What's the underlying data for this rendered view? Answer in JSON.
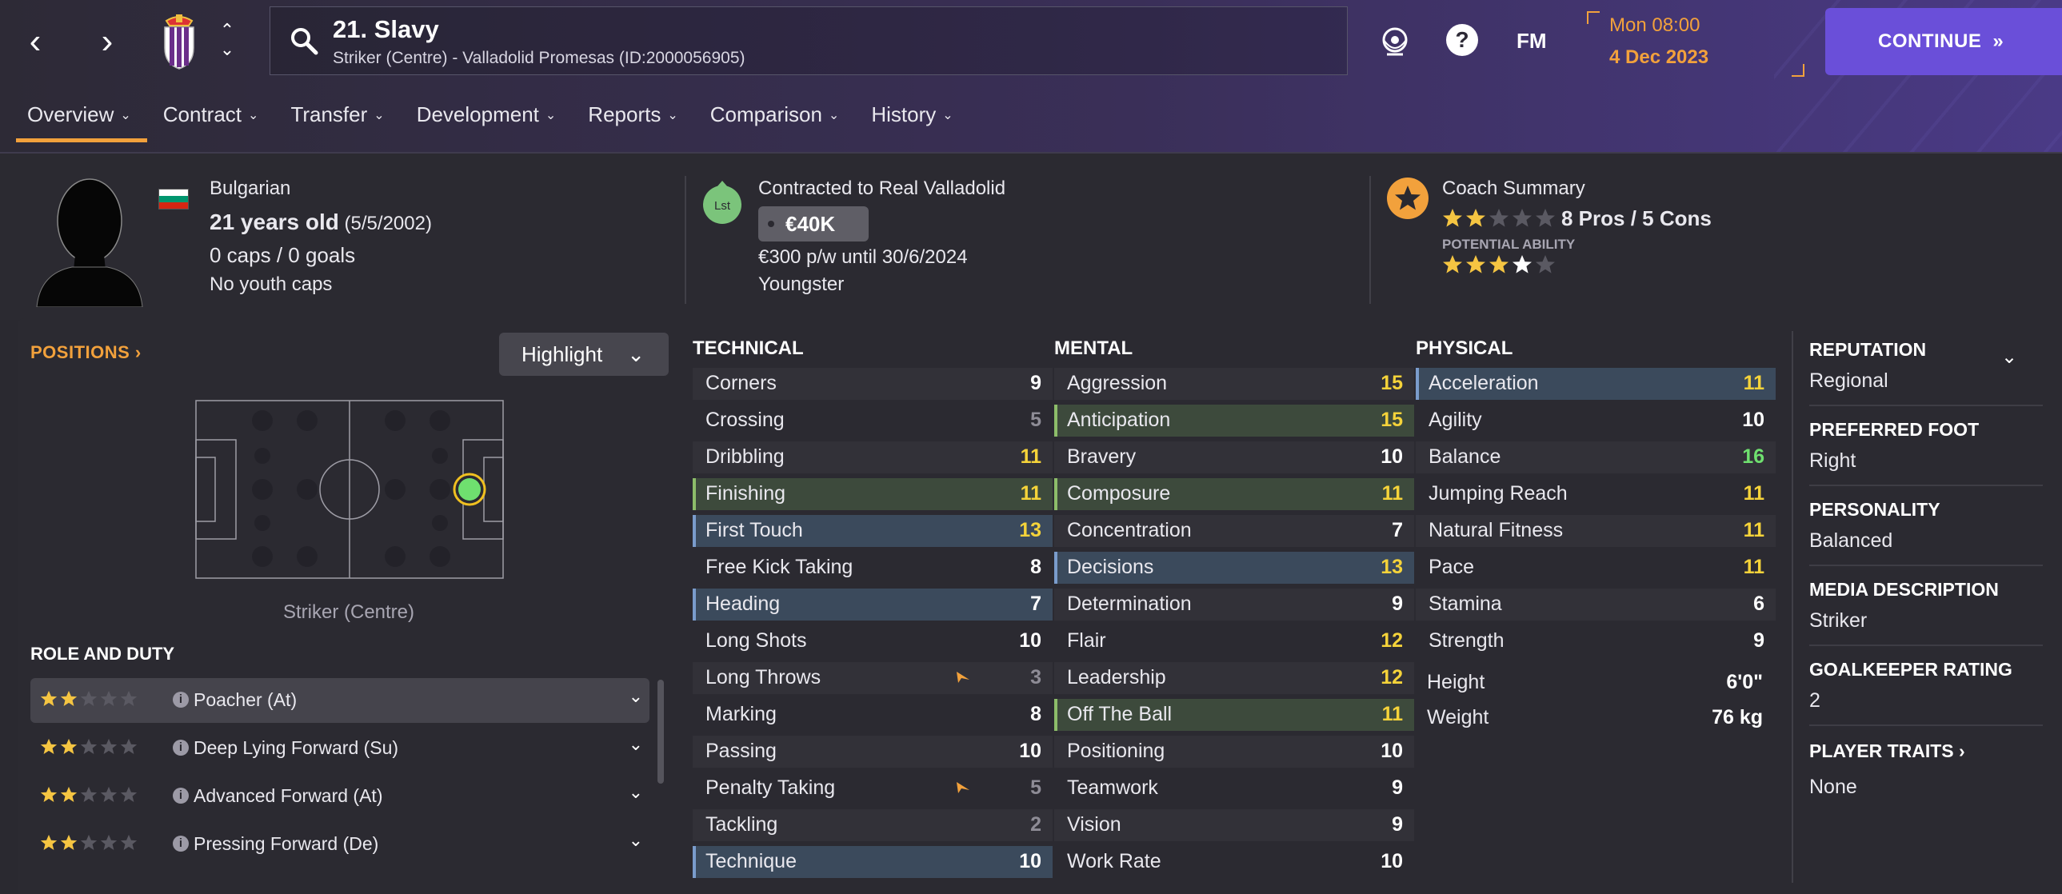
{
  "header": {
    "player_name": "21. Slavy",
    "player_subtitle": "Striker (Centre) - Valladolid Promesas (ID:2000056905)",
    "fm_label": "FM",
    "date_time": "Mon 08:00",
    "date": "4 Dec 2023",
    "continue_label": "CONTINUE",
    "help_label": "?"
  },
  "tabs": [
    {
      "label": "Overview",
      "active": true
    },
    {
      "label": "Contract"
    },
    {
      "label": "Transfer"
    },
    {
      "label": "Development"
    },
    {
      "label": "Reports"
    },
    {
      "label": "Comparison"
    },
    {
      "label": "History"
    }
  ],
  "summary": {
    "nationality": "Bulgarian",
    "age_bold": "21 years old",
    "dob": "(5/5/2002)",
    "caps": "0 caps / 0 goals",
    "youth_caps": "No youth caps",
    "contract_title": "Contracted to Real Valladolid",
    "squad_badge": "Lst",
    "value": "€40K",
    "wage": "€300 p/w until 30/6/2024",
    "contract_type": "Youngster",
    "coach_title": "Coach Summary",
    "coach_stars": 2,
    "pros_cons": "8 Pros / 5 Cons",
    "potential_label": "POTENTIAL ABILITY",
    "potential_stars": 3.5
  },
  "positions": {
    "title": "POSITIONS",
    "highlight_label": "Highlight",
    "position_label": "Striker (Centre)"
  },
  "role_duty": {
    "title": "ROLE AND DUTY",
    "roles": [
      {
        "name": "Poacher (At)",
        "stars": 2
      },
      {
        "name": "Deep Lying Forward (Su)",
        "stars": 2
      },
      {
        "name": "Advanced Forward (At)",
        "stars": 2
      },
      {
        "name": "Pressing Forward (De)",
        "stars": 2
      }
    ]
  },
  "attributes": {
    "technical": {
      "title": "TECHNICAL",
      "items": [
        {
          "name": "Corners",
          "value": "9"
        },
        {
          "name": "Crossing",
          "value": "5"
        },
        {
          "name": "Dribbling",
          "value": "11"
        },
        {
          "name": "Finishing",
          "value": "11",
          "hl": "g"
        },
        {
          "name": "First Touch",
          "value": "13",
          "hl": "b"
        },
        {
          "name": "Free Kick Taking",
          "value": "8"
        },
        {
          "name": "Heading",
          "value": "7",
          "hl": "b"
        },
        {
          "name": "Long Shots",
          "value": "10"
        },
        {
          "name": "Long Throws",
          "value": "3",
          "warn": true
        },
        {
          "name": "Marking",
          "value": "8"
        },
        {
          "name": "Passing",
          "value": "10"
        },
        {
          "name": "Penalty Taking",
          "value": "5",
          "warn": true
        },
        {
          "name": "Tackling",
          "value": "2"
        },
        {
          "name": "Technique",
          "value": "10",
          "hl": "b"
        }
      ]
    },
    "mental": {
      "title": "MENTAL",
      "items": [
        {
          "name": "Aggression",
          "value": "15"
        },
        {
          "name": "Anticipation",
          "value": "15",
          "hl": "g"
        },
        {
          "name": "Bravery",
          "value": "10"
        },
        {
          "name": "Composure",
          "value": "11",
          "hl": "g"
        },
        {
          "name": "Concentration",
          "value": "7"
        },
        {
          "name": "Decisions",
          "value": "13",
          "hl": "b"
        },
        {
          "name": "Determination",
          "value": "9"
        },
        {
          "name": "Flair",
          "value": "12"
        },
        {
          "name": "Leadership",
          "value": "12"
        },
        {
          "name": "Off The Ball",
          "value": "11",
          "hl": "g"
        },
        {
          "name": "Positioning",
          "value": "10"
        },
        {
          "name": "Teamwork",
          "value": "9"
        },
        {
          "name": "Vision",
          "value": "9"
        },
        {
          "name": "Work Rate",
          "value": "10"
        }
      ]
    },
    "physical": {
      "title": "PHYSICAL",
      "items": [
        {
          "name": "Acceleration",
          "value": "11",
          "hl": "b"
        },
        {
          "name": "Agility",
          "value": "10"
        },
        {
          "name": "Balance",
          "value": "16"
        },
        {
          "name": "Jumping Reach",
          "value": "11"
        },
        {
          "name": "Natural Fitness",
          "value": "11"
        },
        {
          "name": "Pace",
          "value": "11"
        },
        {
          "name": "Stamina",
          "value": "6"
        },
        {
          "name": "Strength",
          "value": "9"
        }
      ],
      "height_label": "Height",
      "height": "6'0\"",
      "weight_label": "Weight",
      "weight": "76 kg"
    }
  },
  "details": {
    "reputation_label": "REPUTATION",
    "reputation": "Regional",
    "foot_label": "PREFERRED FOOT",
    "foot": "Right",
    "personality_label": "PERSONALITY",
    "personality": "Balanced",
    "media_label": "MEDIA DESCRIPTION",
    "media": "Striker",
    "gk_label": "GOALKEEPER RATING",
    "gk": "2",
    "traits_label": "PLAYER TRAITS",
    "traits": "None"
  },
  "colors": {
    "accent": "#f2a13c",
    "continue": "#6a4fd9",
    "attr_white": "#ffffff",
    "attr_grey": "#8e8c96",
    "attr_yellow": "#f5d33a",
    "attr_green": "#6fe06f"
  }
}
